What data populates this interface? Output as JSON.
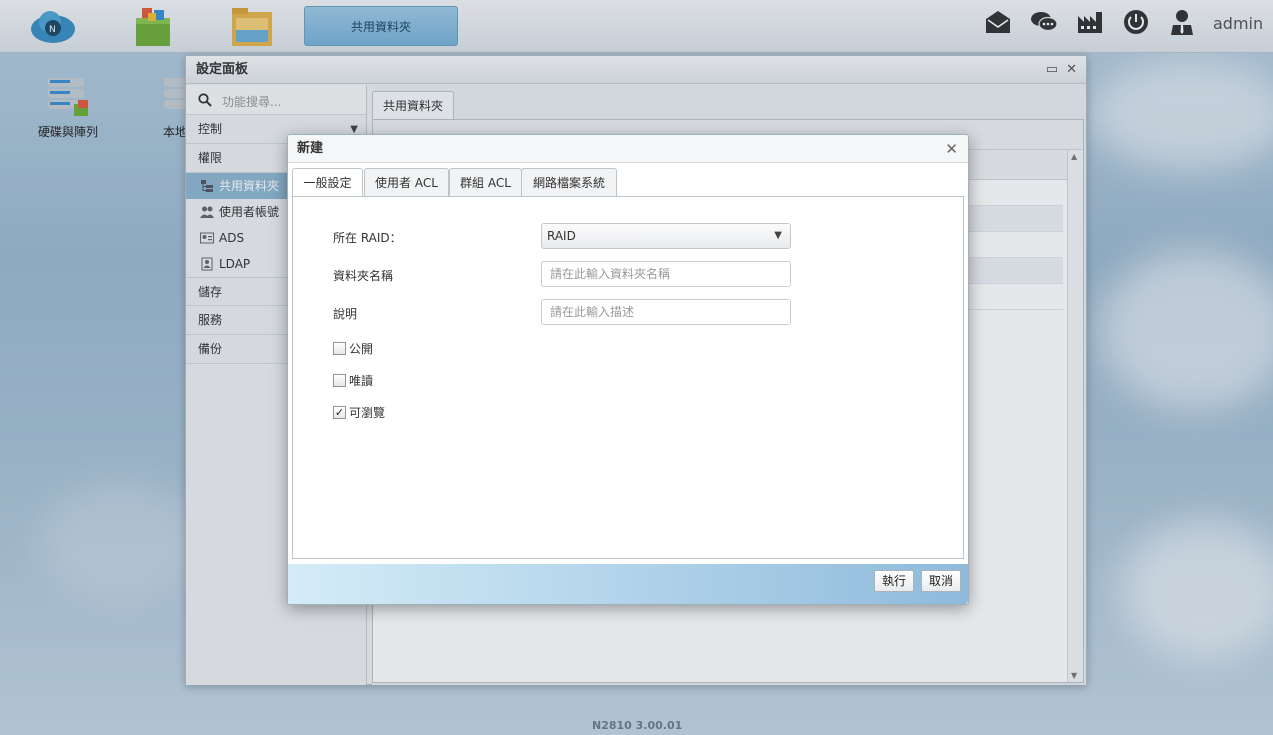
{
  "topbar": {
    "active_task": "共用資料夾",
    "user": "admin",
    "tray_icons": [
      "mail-icon",
      "chat-icon",
      "factory-icon",
      "power-icon",
      "user-icon"
    ],
    "app_icons": [
      "cloud-icon",
      "app-store-icon",
      "file-manager-icon"
    ]
  },
  "desktop": {
    "icons": [
      {
        "label": "硬碟與陣列"
      },
      {
        "label": "本地"
      }
    ]
  },
  "panel": {
    "title": "設定面板",
    "search_placeholder": "功能搜尋...",
    "sections": {
      "control": "控制",
      "privilege": "權限",
      "storage": "儲存",
      "service": "服務",
      "backup": "備份"
    },
    "privilege_items": [
      "共用資料夾",
      "使用者帳號",
      "ADS",
      "LDAP"
    ],
    "content_tab": "共用資料夾"
  },
  "footer": {
    "version": "N2810   3.00.01"
  },
  "dialog": {
    "title": "新建",
    "tabs": [
      "一般設定",
      "使用者 ACL",
      "群組 ACL",
      "網路檔案系統"
    ],
    "raid_label": "所在 RAID：",
    "raid_value": "RAID",
    "name_label": "資料夾名稱",
    "name_placeholder": "請在此輸入資料夾名稱",
    "desc_label": "說明",
    "desc_placeholder": "請在此輸入描述",
    "public_label": "公開",
    "readonly_label": "唯讀",
    "browsable_label": "可瀏覽",
    "browsable_checkmark": "✓",
    "apply_label": "執行",
    "cancel_label": "取消"
  }
}
